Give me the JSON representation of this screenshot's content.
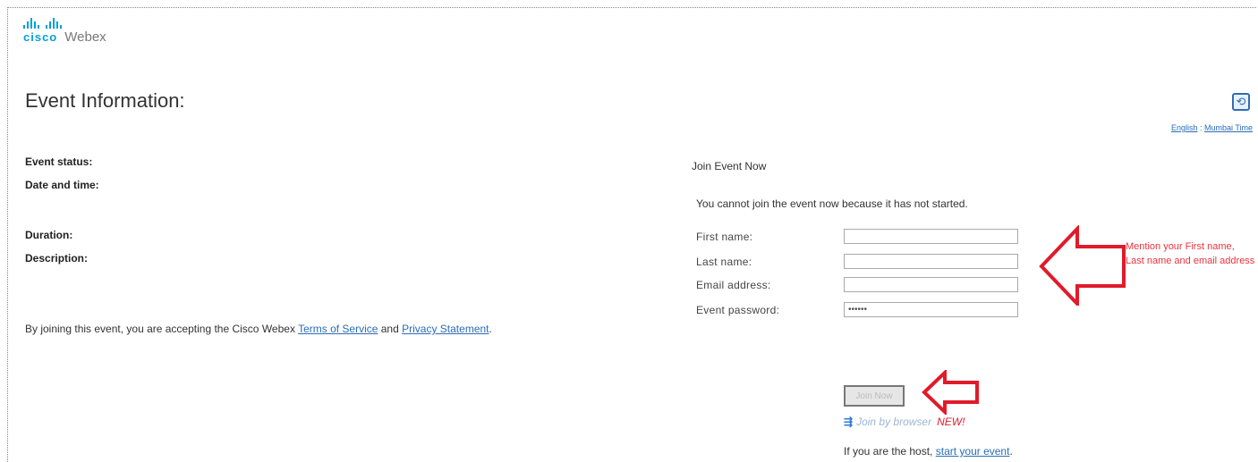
{
  "header": {
    "logo_cisco": "cisco",
    "logo_webex": "Webex"
  },
  "page": {
    "title": "Event Information:",
    "lang_link": "English",
    "lang_sep": " : ",
    "time_link": "Mumbai Time"
  },
  "event_info": {
    "status_label": "Event status:",
    "datetime_label": "Date and time:",
    "duration_label": "Duration:",
    "description_label": "Description:"
  },
  "terms": {
    "prefix": "By joining this event, you are accepting the Cisco Webex ",
    "tos_link": "Terms of Service",
    "and": " and ",
    "privacy_link": "Privacy Statement",
    "suffix": "."
  },
  "join": {
    "title": "Join Event Now",
    "message": "You cannot join the event now because it has not started.",
    "first_name_label": "First name:",
    "last_name_label": "Last name:",
    "email_label": "Email address:",
    "password_label": "Event password:",
    "first_name_value": "",
    "last_name_value": "",
    "email_value": "",
    "password_value": "••••••",
    "join_button": "Join Now",
    "browser_link": "Join by browser",
    "new_badge": "NEW!",
    "host_prefix": "If you are the host, ",
    "host_link": "start your event",
    "host_suffix": "."
  },
  "annotation": {
    "text": "Mention your First name, Last name and email address"
  },
  "colors": {
    "cisco_blue": "#049fd9",
    "link_blue": "#2a6db8",
    "annotation_red": "#e8343f"
  },
  "icons": {
    "refresh": "refresh-icon",
    "browser": "browser-join-icon"
  }
}
